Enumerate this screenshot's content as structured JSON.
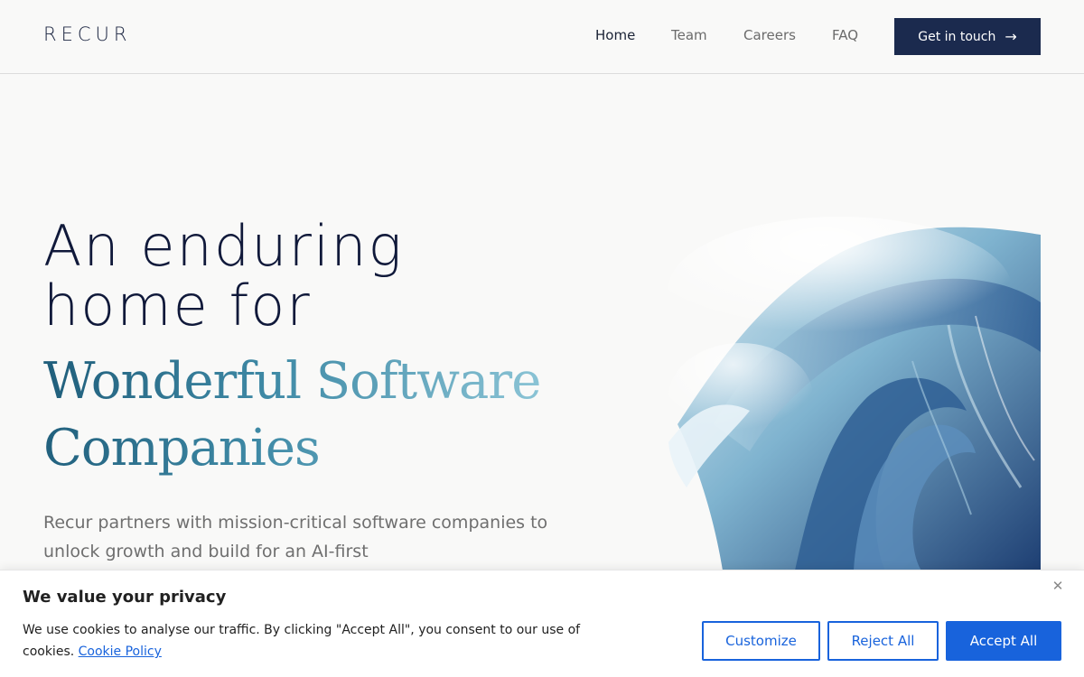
{
  "header": {
    "logo": "RECUR",
    "nav": [
      {
        "label": "Home",
        "active": true
      },
      {
        "label": "Team",
        "active": false
      },
      {
        "label": "Careers",
        "active": false
      },
      {
        "label": "FAQ",
        "active": false
      }
    ],
    "cta_label": "Get in touch",
    "cta_icon": "arrow-right-icon"
  },
  "hero": {
    "title_line1": "An enduring",
    "title_line2": "home for",
    "accent_line1": "Wonderful Software",
    "accent_line2": "Companies",
    "description": "Recur partners with mission-critical software companies to unlock growth and build for an AI-first",
    "image": "ocean-wave-illustration"
  },
  "cookie_banner": {
    "title": "We value your privacy",
    "text": "We use cookies to analyse our traffic. By clicking \"Accept All\", you consent to our use of cookies.",
    "policy_link": "Cookie Policy",
    "close_icon": "close-icon",
    "buttons": {
      "customize": "Customize",
      "reject": "Reject All",
      "accept": "Accept All"
    }
  },
  "colors": {
    "brand_navy": "#1b2a4e",
    "accent_teal": "#3f8aa6",
    "cookie_blue": "#1863dc"
  }
}
